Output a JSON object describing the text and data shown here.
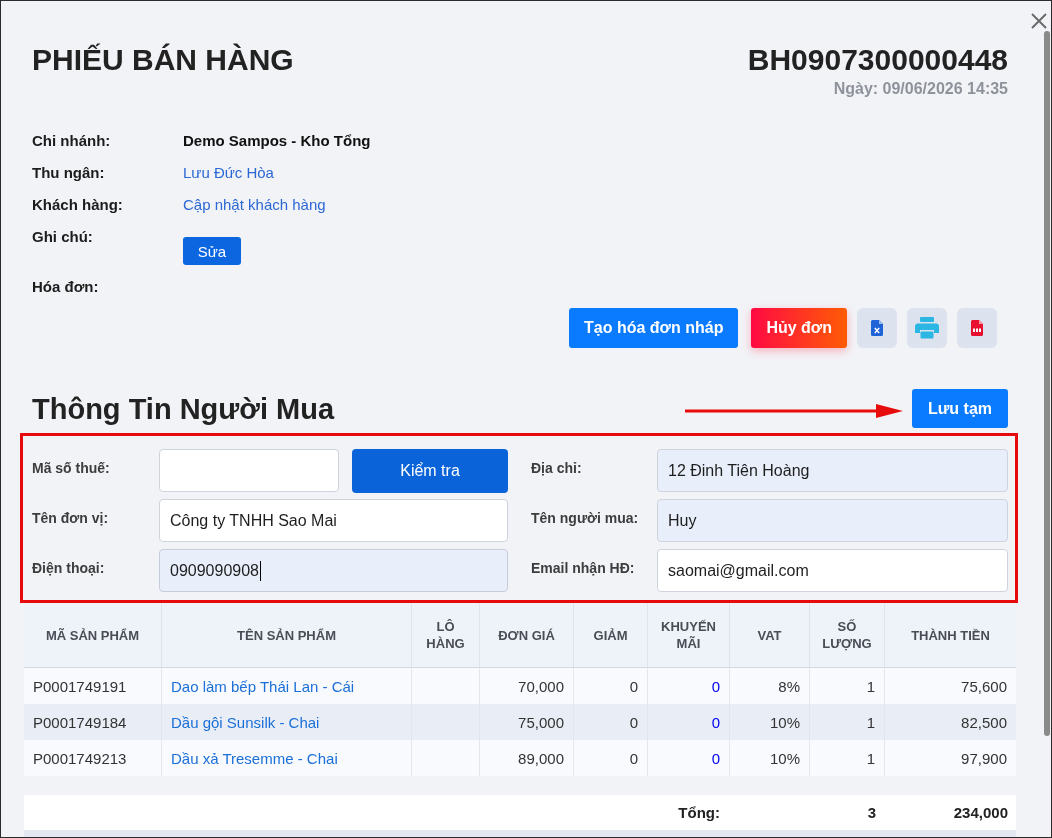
{
  "window": {
    "title": "PHIẾU BÁN HÀNG",
    "code": "BH0907300000448",
    "date": "Ngày: 09/06/2026 14:35"
  },
  "info": [
    {
      "label": "Chi nhánh:",
      "kind": "text",
      "value": "Demo Sampos - Kho Tổng"
    },
    {
      "label": "Thu ngân:",
      "kind": "link",
      "value": "Lưu Đức Hòa"
    },
    {
      "label": "Khách hàng:",
      "kind": "link",
      "value": "Cập nhật khách hàng"
    },
    {
      "label": "Ghi chú:",
      "kind": "button",
      "value": "Sửa"
    },
    {
      "label": "Hóa đơn:",
      "kind": "none"
    }
  ],
  "actions": [
    {
      "kind": "primary",
      "label": "Tạo hóa đơn nháp"
    },
    {
      "kind": "danger",
      "label": "Hủy đơn"
    }
  ],
  "buyer": {
    "title": "Thông Tin Người Mua",
    "save_button": "Lưu tạm",
    "fields": [
      {
        "label": "Mã số thuế:",
        "highlighted": false,
        "focused": false,
        "button": "Kiểm tra"
      },
      {
        "label": "Địa chỉ:",
        "value": "12 Đinh Tiên Hoàng",
        "highlighted": true,
        "focused": false
      },
      {
        "label": "Tên đơn vị:",
        "value": "Công ty TNHH Sao Mai",
        "highlighted": false,
        "focused": false
      },
      {
        "label": "Tên người mua:",
        "value": "Huy",
        "highlighted": true,
        "focused": false
      },
      {
        "label": "Điện thoại:",
        "value": "0909090908",
        "highlighted": true,
        "focused": true
      },
      {
        "label": "Email nhận HĐ:",
        "value": "saomai@gmail.com",
        "highlighted": false,
        "focused": false
      }
    ]
  },
  "table": {
    "columns": [
      {
        "label": "MÃ SẢN PHẨM",
        "kind": "text"
      },
      {
        "label": "TÊN SẢN PHẨM",
        "kind": "link"
      },
      {
        "label": "LÔ HÀNG",
        "kind": "text"
      },
      {
        "label": "ĐƠN GIÁ",
        "kind": "number"
      },
      {
        "label": "GIẢM",
        "kind": "number"
      },
      {
        "label": "KHUYẾN MÃI",
        "kind": "accent_number"
      },
      {
        "label": "VAT",
        "kind": "number"
      },
      {
        "label": "SỐ LƯỢNG",
        "kind": "number"
      },
      {
        "label": "THÀNH TIỀN",
        "kind": "number"
      }
    ],
    "rows": [
      {
        "cells": [
          "P0001749191",
          "Dao làm bếp Thái Lan - Cái",
          null,
          "70,000",
          "0",
          "0",
          "8%",
          "1",
          "75,600"
        ]
      },
      {
        "cells": [
          "P0001749184",
          "Dầu gội Sunsilk - Chai",
          null,
          "75,000",
          "0",
          "0",
          "10%",
          "1",
          "82,500"
        ]
      },
      {
        "cells": [
          "P0001749213",
          "Dầu xả Tresemme - Chai",
          null,
          "89,000",
          "0",
          "0",
          "10%",
          "1",
          "97,900"
        ]
      }
    ],
    "total": {
      "label": "Tổng:",
      "quantity": "3",
      "amount": "234,000"
    }
  }
}
